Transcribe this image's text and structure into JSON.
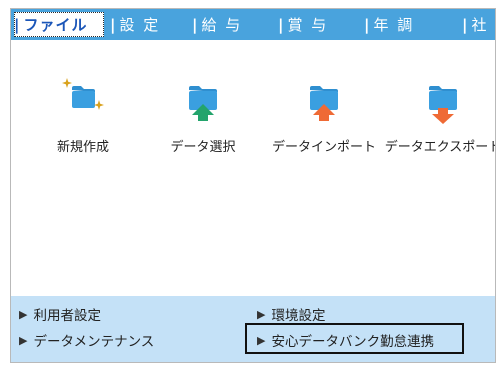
{
  "tabs": [
    {
      "label": "ファイル",
      "active": true
    },
    {
      "label": "設 定",
      "active": false
    },
    {
      "label": "給 与",
      "active": false
    },
    {
      "label": "賞 与",
      "active": false
    },
    {
      "label": "年 調",
      "active": false
    },
    {
      "label": "社",
      "active": false
    }
  ],
  "tab_separator": "|",
  "actions": [
    {
      "label": "新規作成",
      "icon": "new-folder-icon"
    },
    {
      "label": "データ選択",
      "icon": "folder-select-icon"
    },
    {
      "label": "データインポート",
      "icon": "folder-import-icon"
    },
    {
      "label": "データエクスポート",
      "icon": "folder-export-icon"
    }
  ],
  "links": [
    {
      "label": "利用者設定"
    },
    {
      "label": "環境設定"
    },
    {
      "label": "データメンテナンス"
    },
    {
      "label": "安心データバンク勤怠連携"
    }
  ],
  "link_marker": "▶",
  "colors": {
    "tab_bar": "#49a3dd",
    "active_tab_text": "#1b56b8",
    "folder_blue": "#3a9fe0",
    "sparkle": "#d9a21d",
    "arrow_green": "#23a46c",
    "arrow_orange": "#ef6a35",
    "bottom_panel": "#c4e1f7"
  }
}
